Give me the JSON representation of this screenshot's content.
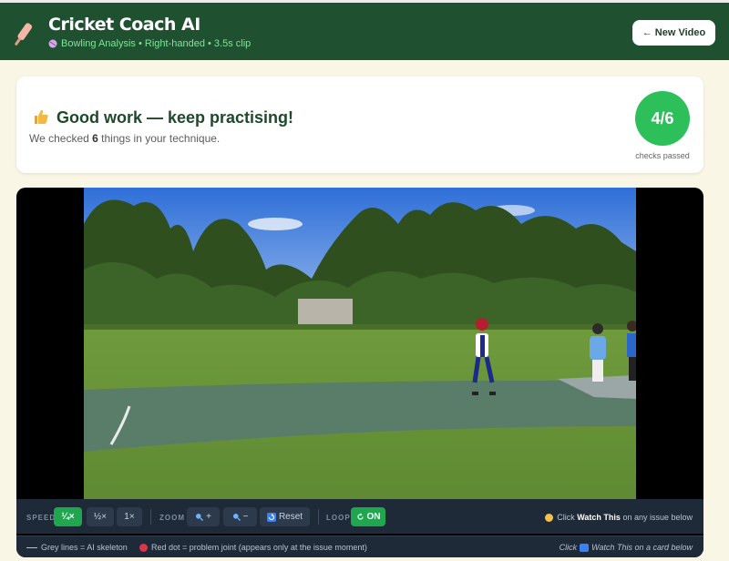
{
  "header": {
    "title": "Cricket Coach AI",
    "subtitle": "Bowling Analysis • Right-handed • 3.5s clip",
    "new_video_label": "← New Video"
  },
  "result": {
    "title": "Good work — keep practising!",
    "desc_prefix": "We checked ",
    "checks_count": "6",
    "desc_suffix": " things in your technique.",
    "score": "4/6",
    "score_label": "checks passed"
  },
  "controls": {
    "speed_label": "SPEED",
    "speeds": [
      "¼×",
      "½×",
      "1×"
    ],
    "active_speed": "¼×",
    "zoom_label": "ZOOM",
    "zoom_in_label": "+",
    "zoom_out_label": "−",
    "reset_label": "Reset",
    "loop_label": "LOOP",
    "loop_state": "ON",
    "hint_prefix": "Click ",
    "hint_bold": "Watch This",
    "hint_suffix": " on any issue below"
  },
  "legend": {
    "grey_lines": "Grey lines = AI skeleton",
    "red_dot": "Red dot = problem joint (appears only at the issue moment)",
    "right_prefix": "Click ",
    "right_suffix": " Watch This on a card below"
  },
  "colors": {
    "header_bg": "#1f5130",
    "accent_green": "#2cbf5a",
    "controls_bg": "#1e2a38",
    "page_bg": "#faf6e6"
  },
  "icons": {
    "logo": "cricket-bat-icon",
    "subtitle": "cricket-ball-icon",
    "result": "thumbs-up-icon",
    "zoom": "magnifier-icon",
    "reset": "reset-icon",
    "loop": "loop-icon",
    "hint": "pointing-finger-icon"
  }
}
